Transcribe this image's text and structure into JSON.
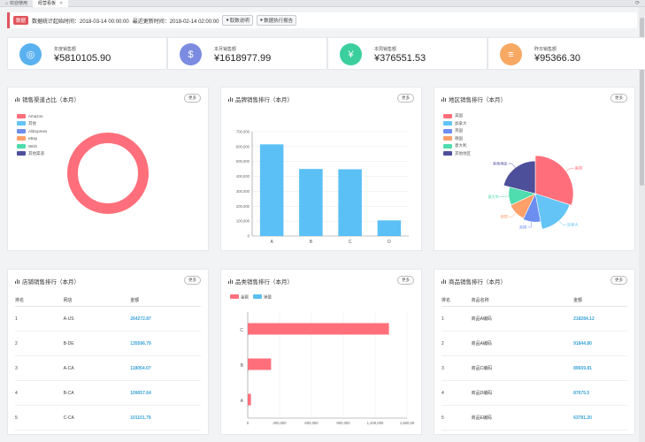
{
  "tabs": [
    {
      "label": "欢迎使用",
      "active": false
    },
    {
      "label": "经营看板",
      "active": true
    }
  ],
  "infobar": {
    "badge": "数据",
    "stat_start": "数据统计起始时间：2018-03-14 00:00:00",
    "updated": "最近更新时间：2018-02-14 02:00:00",
    "btn_explain": "取数说明",
    "btn_report": "数据执行报告"
  },
  "stats": [
    {
      "label": "年度销售额",
      "value": "¥5810105.90",
      "color": "#5ab1ef",
      "icon": "globe-icon"
    },
    {
      "label": "本月销售额",
      "value": "¥1618977.99",
      "color": "#7b8ce0",
      "icon": "money-bag-icon"
    },
    {
      "label": "本周销售额",
      "value": "¥376551.53",
      "color": "#3ccf9e",
      "icon": "wallet-icon"
    },
    {
      "label": "昨日销售额",
      "value": "¥95366.30",
      "color": "#f7a964",
      "icon": "coins-icon"
    }
  ],
  "more_label": "更多",
  "channel": {
    "title": "销售渠道占比（本月）",
    "legend": [
      {
        "name": "Amazon",
        "color": "#ff6f7b"
      },
      {
        "name": "其他",
        "color": "#63c4f5"
      },
      {
        "name": "AliExpress",
        "color": "#6c8ef0"
      },
      {
        "name": "eBay",
        "color": "#ffa06a"
      },
      {
        "name": "Wish",
        "color": "#4fdcae"
      },
      {
        "name": "其他渠道",
        "color": "#4d4f9a"
      }
    ]
  },
  "brand": {
    "title": "品牌销售排行（本月）"
  },
  "region": {
    "title": "地区销售排行（本月）",
    "legend": [
      {
        "name": "美国",
        "color": "#ff6f7b"
      },
      {
        "name": "加拿大",
        "color": "#63c4f5"
      },
      {
        "name": "英国",
        "color": "#6c8ef0"
      },
      {
        "name": "德国",
        "color": "#ffa06a"
      },
      {
        "name": "意大利",
        "color": "#4fdcae"
      },
      {
        "name": "其他地区",
        "color": "#4d4f9a"
      }
    ]
  },
  "store": {
    "title": "店铺销售排行（本月）",
    "headers": [
      "排名",
      "网店",
      "金额"
    ],
    "rows": [
      [
        "1",
        "A-US",
        "264272.87"
      ],
      [
        "2",
        "B-DE",
        "135596.79"
      ],
      [
        "3",
        "A-CA",
        "118054.07"
      ],
      [
        "4",
        "B-CA",
        "109057.64"
      ],
      [
        "5",
        "C-CA",
        "101101.79"
      ]
    ]
  },
  "category": {
    "title": "品类销售排行（本月）",
    "legend": [
      {
        "name": "金额",
        "color": "#ff6f7b"
      },
      {
        "name": "销量",
        "color": "#5bc0f0"
      }
    ]
  },
  "product": {
    "title": "商品销售排行（本月）",
    "headers": [
      "排名",
      "商品名称",
      "金额"
    ],
    "rows": [
      [
        "1",
        "商品A编码",
        "218284.12"
      ],
      [
        "2",
        "商品A编码",
        "91844.80"
      ],
      [
        "3",
        "商品C编码",
        "89659.81"
      ],
      [
        "4",
        "商品D编码",
        "87675.5"
      ],
      [
        "5",
        "商品E编码",
        "63781.20"
      ]
    ]
  },
  "chart_data": [
    {
      "type": "pie",
      "variant": "donut",
      "labels": [
        "Amazon",
        "其他",
        "AliExpress",
        "eBay",
        "Wish",
        "其他渠道"
      ],
      "values": [
        100,
        0,
        0,
        0,
        0,
        0
      ]
    },
    {
      "type": "bar",
      "categories": [
        "A",
        "B",
        "C",
        "D"
      ],
      "values": [
        615000,
        450000,
        448000,
        105000
      ],
      "ylim": [
        0,
        700000
      ],
      "yticks": [
        "0",
        "100,000",
        "200,000",
        "300,000",
        "400,000",
        "500,000",
        "600,000",
        "700,000"
      ],
      "color": "#5bc0f5"
    },
    {
      "type": "pie",
      "variant": "rose",
      "labels": [
        "美国",
        "加拿大",
        "英国",
        "德国",
        "意大利",
        "其他地区"
      ],
      "values": [
        30,
        17,
        10,
        11,
        11,
        21
      ],
      "radii": [
        1.0,
        0.95,
        0.75,
        0.72,
        0.7,
        0.86
      ]
    },
    {
      "type": "bar",
      "orientation": "horizontal",
      "categories": [
        "A",
        "B",
        "C"
      ],
      "series": [
        {
          "name": "金额",
          "values": [
            30000,
            220000,
            1330000
          ]
        },
        {
          "name": "销量",
          "values": [
            0,
            0,
            0
          ]
        }
      ],
      "xlim": [
        0,
        1500000
      ],
      "xticks": [
        "0",
        "300,000",
        "600,000",
        "900,000",
        "1,200,000",
        "1,500,00"
      ]
    }
  ]
}
